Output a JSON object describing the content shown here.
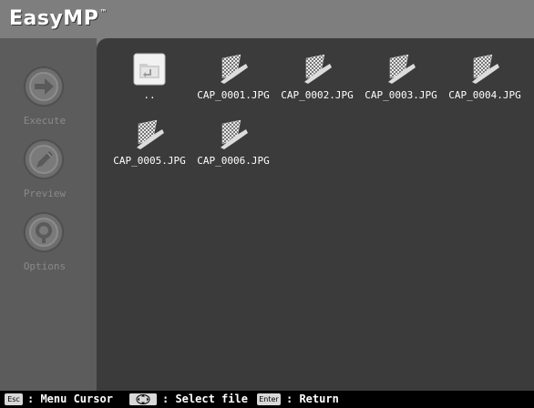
{
  "app": {
    "title": "EasyMP",
    "trademark": "™"
  },
  "sidebar": {
    "items": [
      {
        "label": "Execute",
        "icon": "arrow-right-icon"
      },
      {
        "label": "Preview",
        "icon": "pencil-icon"
      },
      {
        "label": "Options",
        "icon": "wrench-icon"
      }
    ]
  },
  "files": [
    {
      "name": "..",
      "icon": "parent-folder-icon"
    },
    {
      "name": "CAP_0001.JPG",
      "icon": "jpg-file-icon"
    },
    {
      "name": "CAP_0002.JPG",
      "icon": "jpg-file-icon"
    },
    {
      "name": "CAP_0003.JPG",
      "icon": "jpg-file-icon"
    },
    {
      "name": "CAP_0004.JPG",
      "icon": "jpg-file-icon"
    },
    {
      "name": "CAP_0005.JPG",
      "icon": "jpg-file-icon"
    },
    {
      "name": "CAP_0006.JPG",
      "icon": "jpg-file-icon"
    }
  ],
  "footer": {
    "esc_key": "Esc",
    "esc_text": ": Menu Cursor",
    "select_text": ": Select file",
    "enter_key": "Enter",
    "enter_text": ": Return"
  },
  "colors": {
    "header": "#7e7e7e",
    "sidebar": "#5c5c5c",
    "main": "#3b3b3b",
    "footer": "#000000"
  }
}
